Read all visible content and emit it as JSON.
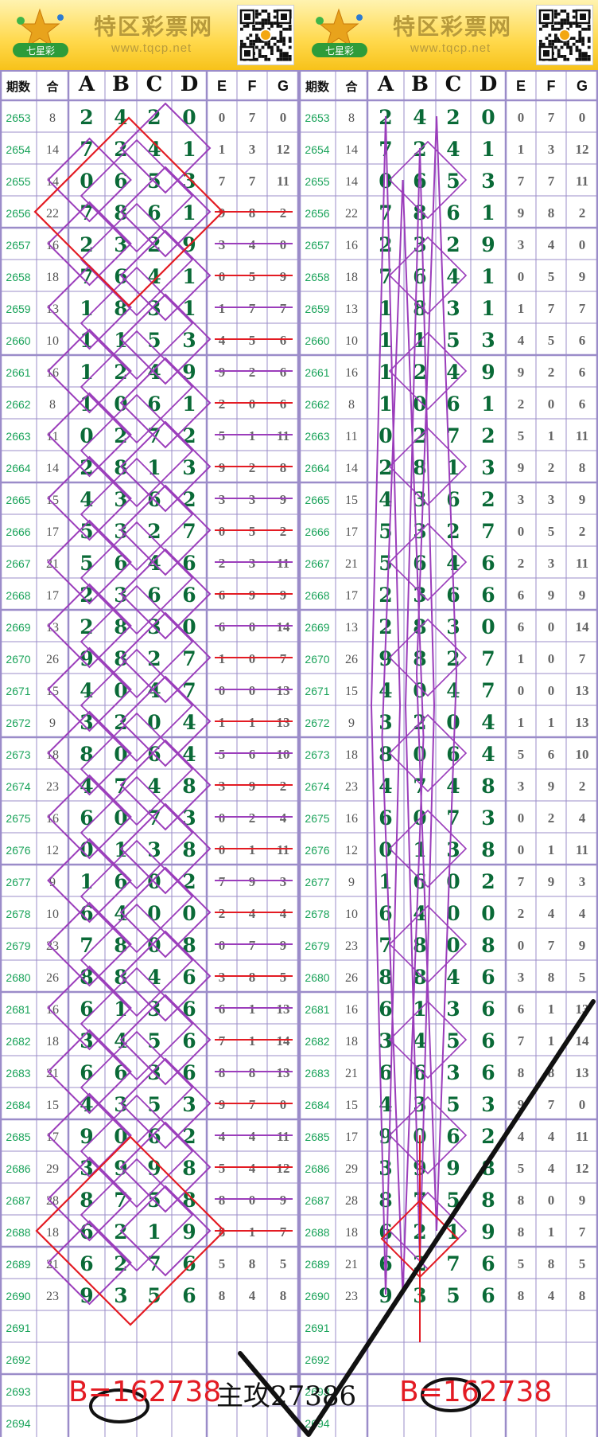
{
  "banner": {
    "title": "特区彩票网",
    "url": "www.tqcp.net",
    "logo_icon": "qixingcai-logo",
    "qr_icon": "qr-code"
  },
  "headers": [
    "期数",
    "合",
    "A",
    "B",
    "C",
    "D",
    "E",
    "F",
    "G"
  ],
  "rows": [
    {
      "p": "2653",
      "s": "8",
      "m": [
        "2",
        "4",
        "2",
        "0"
      ],
      "x": [
        "0",
        "7",
        "0"
      ]
    },
    {
      "p": "2654",
      "s": "14",
      "m": [
        "7",
        "2",
        "4",
        "1"
      ],
      "x": [
        "1",
        "3",
        "12"
      ]
    },
    {
      "p": "2655",
      "s": "14",
      "m": [
        "0",
        "6",
        "5",
        "3"
      ],
      "x": [
        "7",
        "7",
        "11"
      ]
    },
    {
      "p": "2656",
      "s": "22",
      "m": [
        "7",
        "8",
        "6",
        "1"
      ],
      "x": [
        "9",
        "8",
        "2"
      ]
    },
    {
      "p": "2657",
      "s": "16",
      "m": [
        "2",
        "3",
        "2",
        "9"
      ],
      "x": [
        "3",
        "4",
        "0"
      ]
    },
    {
      "p": "2658",
      "s": "18",
      "m": [
        "7",
        "6",
        "4",
        "1"
      ],
      "x": [
        "0",
        "5",
        "9"
      ]
    },
    {
      "p": "2659",
      "s": "13",
      "m": [
        "1",
        "8",
        "3",
        "1"
      ],
      "x": [
        "1",
        "7",
        "7"
      ]
    },
    {
      "p": "2660",
      "s": "10",
      "m": [
        "1",
        "1",
        "5",
        "3"
      ],
      "x": [
        "4",
        "5",
        "6"
      ]
    },
    {
      "p": "2661",
      "s": "16",
      "m": [
        "1",
        "2",
        "4",
        "9"
      ],
      "x": [
        "9",
        "2",
        "6"
      ]
    },
    {
      "p": "2662",
      "s": "8",
      "m": [
        "1",
        "0",
        "6",
        "1"
      ],
      "x": [
        "2",
        "0",
        "6"
      ]
    },
    {
      "p": "2663",
      "s": "11",
      "m": [
        "0",
        "2",
        "7",
        "2"
      ],
      "x": [
        "5",
        "1",
        "11"
      ]
    },
    {
      "p": "2664",
      "s": "14",
      "m": [
        "2",
        "8",
        "1",
        "3"
      ],
      "x": [
        "9",
        "2",
        "8"
      ]
    },
    {
      "p": "2665",
      "s": "15",
      "m": [
        "4",
        "3",
        "6",
        "2"
      ],
      "x": [
        "3",
        "3",
        "9"
      ]
    },
    {
      "p": "2666",
      "s": "17",
      "m": [
        "5",
        "3",
        "2",
        "7"
      ],
      "x": [
        "0",
        "5",
        "2"
      ]
    },
    {
      "p": "2667",
      "s": "21",
      "m": [
        "5",
        "6",
        "4",
        "6"
      ],
      "x": [
        "2",
        "3",
        "11"
      ]
    },
    {
      "p": "2668",
      "s": "17",
      "m": [
        "2",
        "3",
        "6",
        "6"
      ],
      "x": [
        "6",
        "9",
        "9"
      ]
    },
    {
      "p": "2669",
      "s": "13",
      "m": [
        "2",
        "8",
        "3",
        "0"
      ],
      "x": [
        "6",
        "0",
        "14"
      ]
    },
    {
      "p": "2670",
      "s": "26",
      "m": [
        "9",
        "8",
        "2",
        "7"
      ],
      "x": [
        "1",
        "0",
        "7"
      ]
    },
    {
      "p": "2671",
      "s": "15",
      "m": [
        "4",
        "0",
        "4",
        "7"
      ],
      "x": [
        "0",
        "0",
        "13"
      ]
    },
    {
      "p": "2672",
      "s": "9",
      "m": [
        "3",
        "2",
        "0",
        "4"
      ],
      "x": [
        "1",
        "1",
        "13"
      ]
    },
    {
      "p": "2673",
      "s": "18",
      "m": [
        "8",
        "0",
        "6",
        "4"
      ],
      "x": [
        "5",
        "6",
        "10"
      ]
    },
    {
      "p": "2674",
      "s": "23",
      "m": [
        "4",
        "7",
        "4",
        "8"
      ],
      "x": [
        "3",
        "9",
        "2"
      ]
    },
    {
      "p": "2675",
      "s": "16",
      "m": [
        "6",
        "0",
        "7",
        "3"
      ],
      "x": [
        "0",
        "2",
        "4"
      ]
    },
    {
      "p": "2676",
      "s": "12",
      "m": [
        "0",
        "1",
        "3",
        "8"
      ],
      "x": [
        "0",
        "1",
        "11"
      ]
    },
    {
      "p": "2677",
      "s": "9",
      "m": [
        "1",
        "6",
        "0",
        "2"
      ],
      "x": [
        "7",
        "9",
        "3"
      ]
    },
    {
      "p": "2678",
      "s": "10",
      "m": [
        "6",
        "4",
        "0",
        "0"
      ],
      "x": [
        "2",
        "4",
        "4"
      ]
    },
    {
      "p": "2679",
      "s": "23",
      "m": [
        "7",
        "8",
        "0",
        "8"
      ],
      "x": [
        "0",
        "7",
        "9"
      ]
    },
    {
      "p": "2680",
      "s": "26",
      "m": [
        "8",
        "8",
        "4",
        "6"
      ],
      "x": [
        "3",
        "8",
        "5"
      ]
    },
    {
      "p": "2681",
      "s": "16",
      "m": [
        "6",
        "1",
        "3",
        "6"
      ],
      "x": [
        "6",
        "1",
        "13"
      ]
    },
    {
      "p": "2682",
      "s": "18",
      "m": [
        "3",
        "4",
        "5",
        "6"
      ],
      "x": [
        "7",
        "1",
        "14"
      ]
    },
    {
      "p": "2683",
      "s": "21",
      "m": [
        "6",
        "6",
        "3",
        "6"
      ],
      "x": [
        "8",
        "8",
        "13"
      ]
    },
    {
      "p": "2684",
      "s": "15",
      "m": [
        "4",
        "3",
        "5",
        "3"
      ],
      "x": [
        "9",
        "7",
        "0"
      ]
    },
    {
      "p": "2685",
      "s": "17",
      "m": [
        "9",
        "0",
        "6",
        "2"
      ],
      "x": [
        "4",
        "4",
        "11"
      ]
    },
    {
      "p": "2686",
      "s": "29",
      "m": [
        "3",
        "9",
        "9",
        "8"
      ],
      "x": [
        "5",
        "4",
        "12"
      ]
    },
    {
      "p": "2687",
      "s": "28",
      "m": [
        "8",
        "7",
        "5",
        "8"
      ],
      "x": [
        "8",
        "0",
        "9"
      ]
    },
    {
      "p": "2688",
      "s": "18",
      "m": [
        "6",
        "2",
        "1",
        "9"
      ],
      "x": [
        "8",
        "1",
        "7"
      ]
    },
    {
      "p": "2689",
      "s": "21",
      "m": [
        "6",
        "2",
        "7",
        "6"
      ],
      "x": [
        "5",
        "8",
        "5"
      ]
    },
    {
      "p": "2690",
      "s": "23",
      "m": [
        "9",
        "3",
        "5",
        "6"
      ],
      "x": [
        "8",
        "4",
        "8"
      ]
    },
    {
      "p": "2691",
      "s": "",
      "m": [
        "",
        "",
        "",
        ""
      ],
      "x": [
        "",
        "",
        ""
      ]
    },
    {
      "p": "2692",
      "s": "",
      "m": [
        "",
        "",
        "",
        ""
      ],
      "x": [
        "",
        "",
        ""
      ]
    },
    {
      "p": "2693",
      "s": "",
      "m": [
        "",
        "",
        "",
        ""
      ],
      "x": [
        "",
        "",
        ""
      ]
    },
    {
      "p": "2694",
      "s": "",
      "m": [
        "",
        "",
        "",
        ""
      ],
      "x": [
        "",
        "",
        ""
      ]
    }
  ],
  "notes": {
    "left": "B=162738",
    "middle": "主攻27386",
    "right": "B=162738"
  },
  "colors": {
    "grid_line": "#9b8cc9",
    "period_text": "#1aa35a",
    "main_digit": "#0a6a37",
    "diamond_red": "#e31b23",
    "diamond_purple": "#9b3dbb",
    "handwriting": "#111111"
  }
}
